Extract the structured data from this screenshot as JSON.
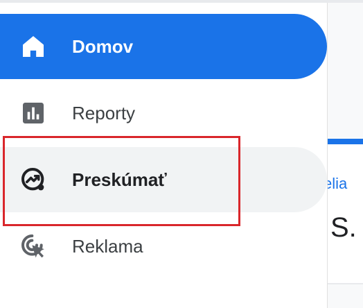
{
  "nav": {
    "items": [
      {
        "id": "home",
        "label": "Domov",
        "icon": "home-icon",
        "state": "active"
      },
      {
        "id": "reports",
        "label": "Reporty",
        "icon": "bar-chart-icon",
        "state": "default"
      },
      {
        "id": "explore",
        "label": "Preskúmať",
        "icon": "explore-icon",
        "state": "hover"
      },
      {
        "id": "advertising",
        "label": "Reklama",
        "icon": "ads-click-icon",
        "state": "default"
      }
    ]
  },
  "content": {
    "link_fragment": "elia",
    "heading_fragment": "S."
  },
  "colors": {
    "accent": "#1a73e8",
    "highlight_border": "#d9262b",
    "hover_bg": "#f1f3f4",
    "text": "#3c4043"
  }
}
